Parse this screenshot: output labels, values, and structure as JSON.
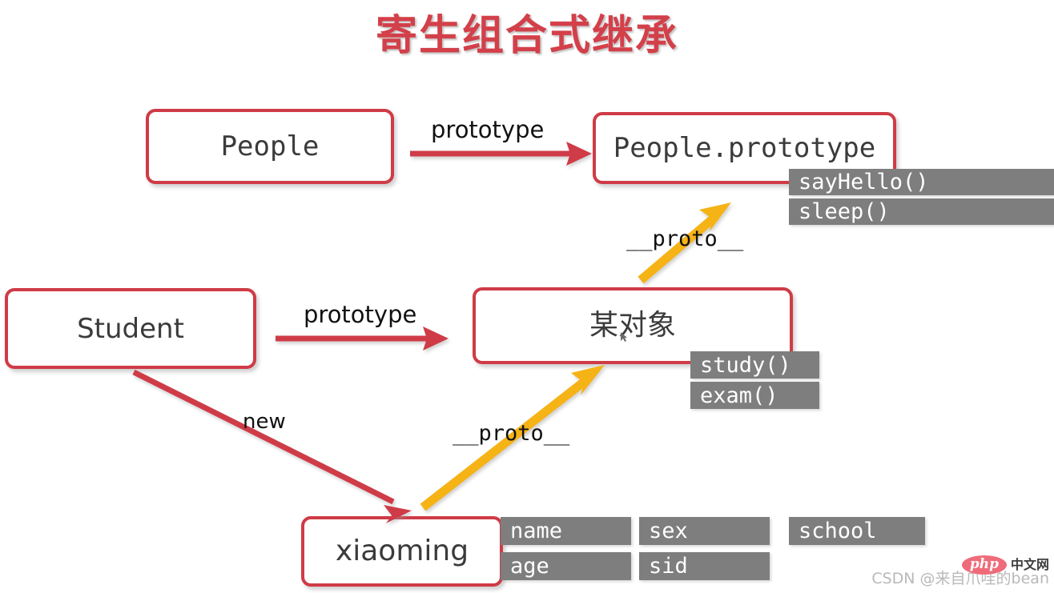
{
  "title": "寄生组合式继承",
  "colors": {
    "title": "#d3404a",
    "box_border": "#cf3b46",
    "chip_bg": "#7e7e7e",
    "red_arrow": "#cf3b46",
    "yellow_arrow": "#f5b312",
    "text": "#3b3b3b"
  },
  "boxes": {
    "people": {
      "label": "People"
    },
    "people_prototype": {
      "label": "People.prototype"
    },
    "student": {
      "label": "Student"
    },
    "some_object": {
      "label": "某对象"
    },
    "xiaoming": {
      "label": "xiaoming"
    }
  },
  "chips": {
    "people_prototype": [
      {
        "label": "sayHello()"
      },
      {
        "label": "sleep()"
      }
    ],
    "some_object": [
      {
        "label": "study()"
      },
      {
        "label": "exam()"
      }
    ],
    "xiaoming": [
      {
        "label": "name"
      },
      {
        "label": "age"
      },
      {
        "label": "sex"
      },
      {
        "label": "sid"
      },
      {
        "label": "school"
      }
    ]
  },
  "edges": {
    "people_to_prototype": {
      "label": "prototype",
      "color": "#cf3b46"
    },
    "someobject_to_peopleprototype": {
      "label": "__proto__",
      "color": "#f5b312"
    },
    "student_to_someobject": {
      "label": "prototype",
      "color": "#cf3b46"
    },
    "student_to_xiaoming": {
      "label": "new",
      "color": "#cf3b46"
    },
    "xiaoming_to_someobject": {
      "label": "__proto__",
      "color": "#f5b312"
    }
  },
  "watermark": {
    "text": "CSDN @来自爪哇的bean",
    "badge_php": "php",
    "badge_cn": "中文网"
  }
}
